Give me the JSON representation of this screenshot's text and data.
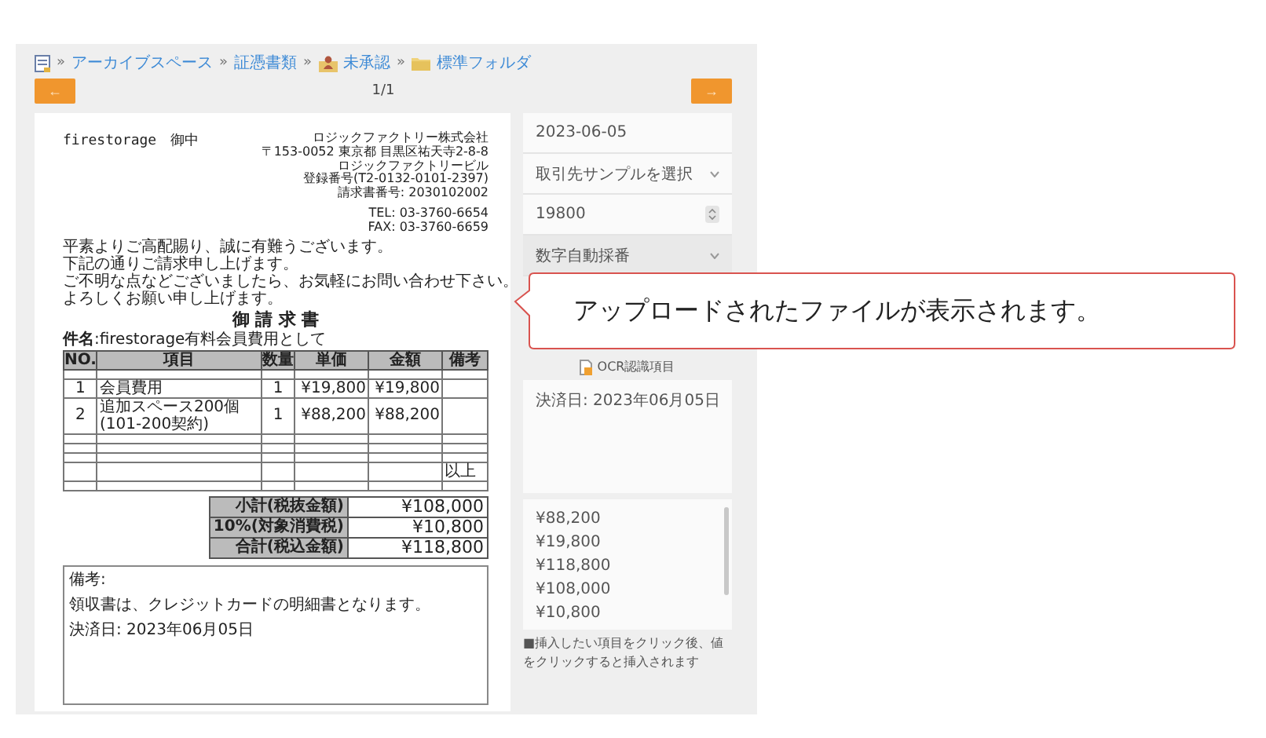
{
  "breadcrumb": [
    {
      "label": "アーカイブスペース",
      "kind": "plain",
      "separator": "»"
    },
    {
      "label": "証憑書類",
      "kind": "plain",
      "separator": "»"
    },
    {
      "label": "未承認",
      "kind": "user-folder",
      "separator": "»"
    },
    {
      "label": "標準フォルダ",
      "kind": "folder",
      "separator": "»"
    }
  ],
  "pager": {
    "prev": "←",
    "page": "1/1",
    "next": "→"
  },
  "document": {
    "addressee": "firestorage　御中",
    "issuer": [
      "ロジックファクトリー株式会社",
      "〒153-0052 東京都 目黒区祐天寺2-8-8",
      "ロジックファクトリービル",
      "登録番号(T2-0132-0101-2397)",
      "請求書番号: 2030102002"
    ],
    "contact": [
      "TEL: 03-3760-6654",
      "FAX: 03-3760-6659"
    ],
    "greeting": [
      "平素よりご高配賜り、誠に有難うございます。",
      "下記の通りご請求申し上げます。",
      "ご不明な点などございましたら、お気軽にお問い合わせ下さい。",
      "よろしくお願い申し上げます。"
    ],
    "title": "御 請 求 書",
    "subject": "**件名**:firestorage有料会員費用として",
    "table": {
      "columns": [
        "NO.",
        "項目",
        "数量",
        "単価",
        "金額",
        "備考"
      ],
      "rows": [
        {
          "kind": "blank"
        },
        {
          "kind": "item",
          "cells": [
            "1",
            "会員費用",
            "1",
            "¥19,800",
            "¥19,800"
          ]
        },
        {
          "kind": "item",
          "cells": [
            "2",
            "追加スペース200個(101-200契約)",
            "1",
            "¥88,200",
            "¥88,200"
          ]
        },
        {
          "kind": "blank"
        },
        {
          "kind": "blank"
        },
        {
          "kind": "blank"
        },
        {
          "kind": "note",
          "text": "以上"
        },
        {
          "kind": "blank"
        }
      ]
    },
    "totals": [
      {
        "label": "小計(税抜金額)",
        "value": "¥108,000"
      },
      {
        "label": "10%(対象消費税)",
        "value": "¥10,800"
      },
      {
        "label": "合計(税込金額)",
        "value": "¥118,800"
      }
    ],
    "remarks": {
      "label": "備考:",
      "lines": [
        "領収書は、クレジットカードの明細書となります。",
        "決済日: 2023年06月05日"
      ]
    }
  },
  "fields": [
    {
      "kind": "date",
      "value": "2023-06-05",
      "disabled": false
    },
    {
      "kind": "select",
      "value": "取引先サンプルを選択",
      "disabled": false
    },
    {
      "kind": "number",
      "value": "19800",
      "disabled": false
    },
    {
      "kind": "select",
      "value": "数字自動採番",
      "disabled": true
    }
  ],
  "ocr": {
    "label": "OCR認識項目",
    "text": "決済日: 2023年06月05日",
    "candidates": [
      "¥88,200",
      "¥19,800",
      "¥118,800",
      "¥108,000",
      "¥10,800"
    ],
    "hint": "■挿入したい項目をクリック後、値をクリックすると挿入されます"
  },
  "callout": {
    "text": "アップロードされたファイルが表示されます。"
  }
}
